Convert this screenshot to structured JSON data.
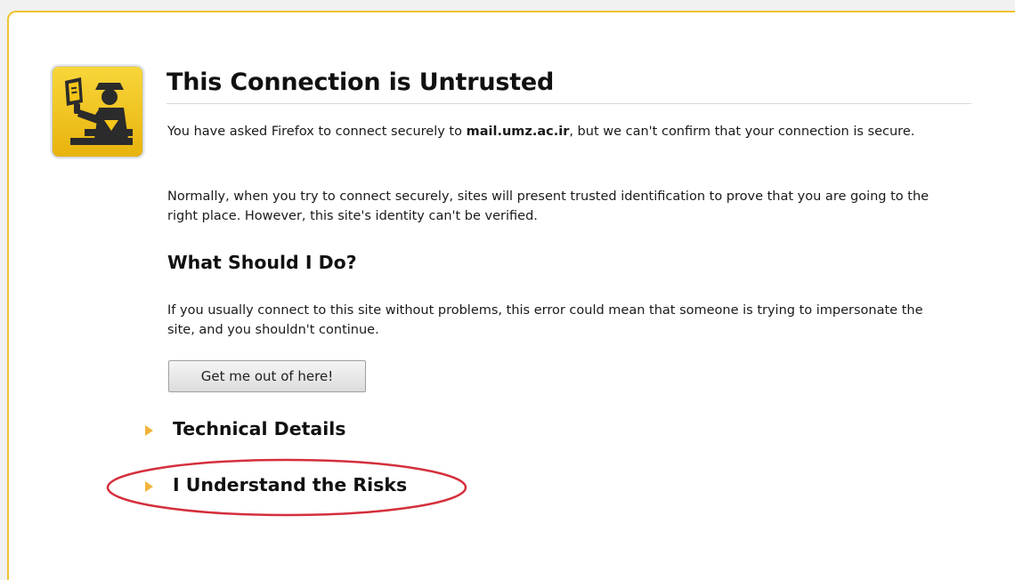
{
  "page": {
    "title": "This Connection is Untrusted",
    "paragraph1": {
      "before": "You have asked Firefox to connect securely to ",
      "host": "mail.umz.ac.ir",
      "after": ", but we can't confirm that your connection is secure."
    },
    "paragraph2": "Normally, when you try to connect securely, sites will present trusted identification to prove that you are going to the right place. However, this site's identity can't be verified.",
    "subheading": "What Should I Do?",
    "paragraph3": "If you usually connect to this site without problems, this error could mean that someone is trying to impersonate the site, and you shouldn't continue.",
    "button_label": "Get me out of here!",
    "expanders": {
      "technical": "Technical Details",
      "risks": "I Understand the Risks"
    }
  },
  "icons": {
    "main": "security-officer-icon",
    "expander": "triangle-right-icon"
  },
  "colors": {
    "frame_border": "#f1c232",
    "icon_background": "#f5c518",
    "expander_triangle": "#f2b43a",
    "annotation_circle": "#d42f3c"
  }
}
